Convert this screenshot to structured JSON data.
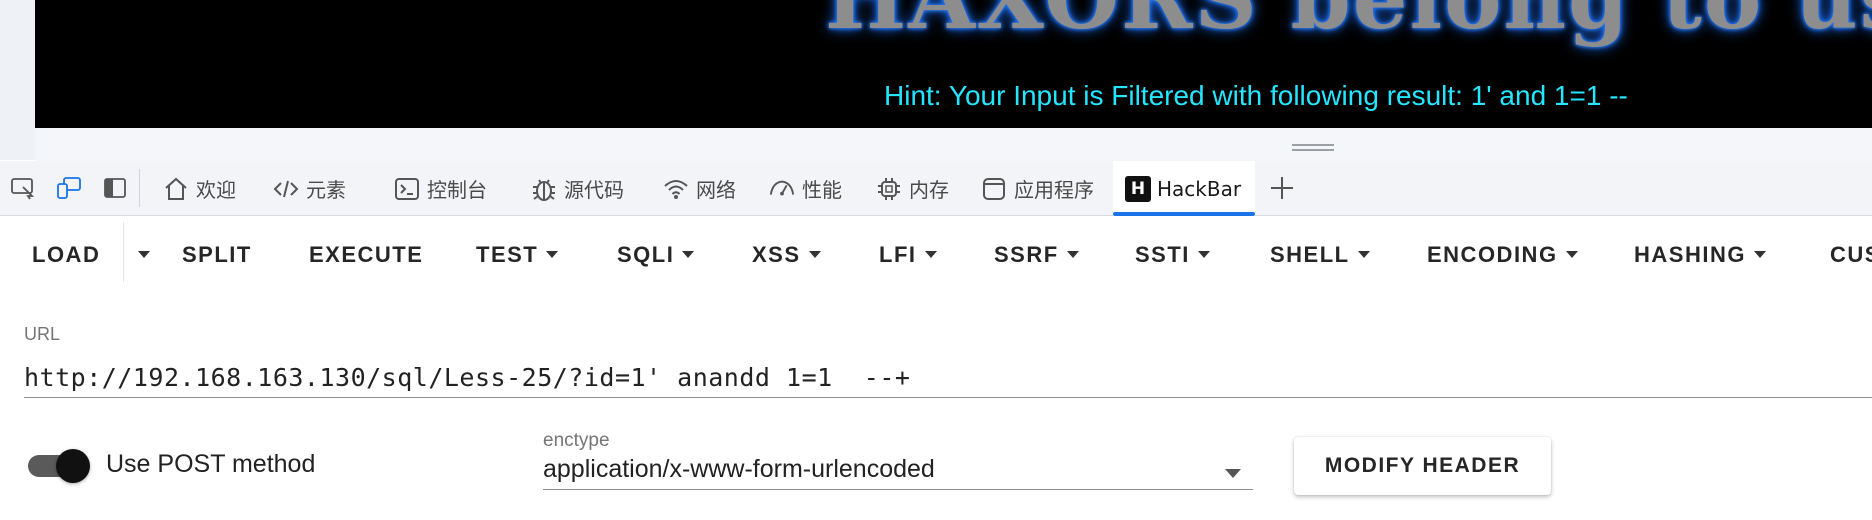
{
  "page": {
    "banner_text": "HAXORS belong to us!",
    "hint": "Hint: Your Input is Filtered with following result: 1' and 1=1 --"
  },
  "devtools": {
    "tools": [
      {
        "name": "inspect-element-icon"
      },
      {
        "name": "device-emulation-icon"
      },
      {
        "name": "dock-panel-icon"
      }
    ],
    "tabs": [
      {
        "label": "欢迎",
        "icon": "home-icon"
      },
      {
        "label": "元素",
        "icon": "code-brackets-icon"
      },
      {
        "label": "控制台",
        "icon": "console-icon"
      },
      {
        "label": "源代码",
        "icon": "bug-icon"
      },
      {
        "label": "网络",
        "icon": "wifi-icon"
      },
      {
        "label": "性能",
        "icon": "performance-gauge-icon"
      },
      {
        "label": "内存",
        "icon": "chip-icon"
      },
      {
        "label": "应用程序",
        "icon": "application-icon"
      },
      {
        "label": "HackBar",
        "icon": "hackbar-logo-icon",
        "logo_letter": "H",
        "active": true
      }
    ],
    "accent_color": "#1a73e8"
  },
  "hackbar": {
    "menu": {
      "load": "LOAD",
      "split": "SPLIT",
      "execute": "EXECUTE",
      "test": "TEST",
      "sqli": "SQLI",
      "xss": "XSS",
      "lfi": "LFI",
      "ssrf": "SSRF",
      "ssti": "SSTI",
      "shell": "SHELL",
      "encoding": "ENCODING",
      "hashing": "HASHING",
      "custom": "CUS"
    },
    "url": {
      "label": "URL",
      "value": "http://192.168.163.130/sql/Less-25/?id=1' anandd 1=1  --+"
    },
    "post": {
      "label": "Use POST method",
      "enabled": true
    },
    "enctype": {
      "label": "enctype",
      "value": "application/x-www-form-urlencoded"
    },
    "modify_header": "MODIFY HEADER"
  }
}
